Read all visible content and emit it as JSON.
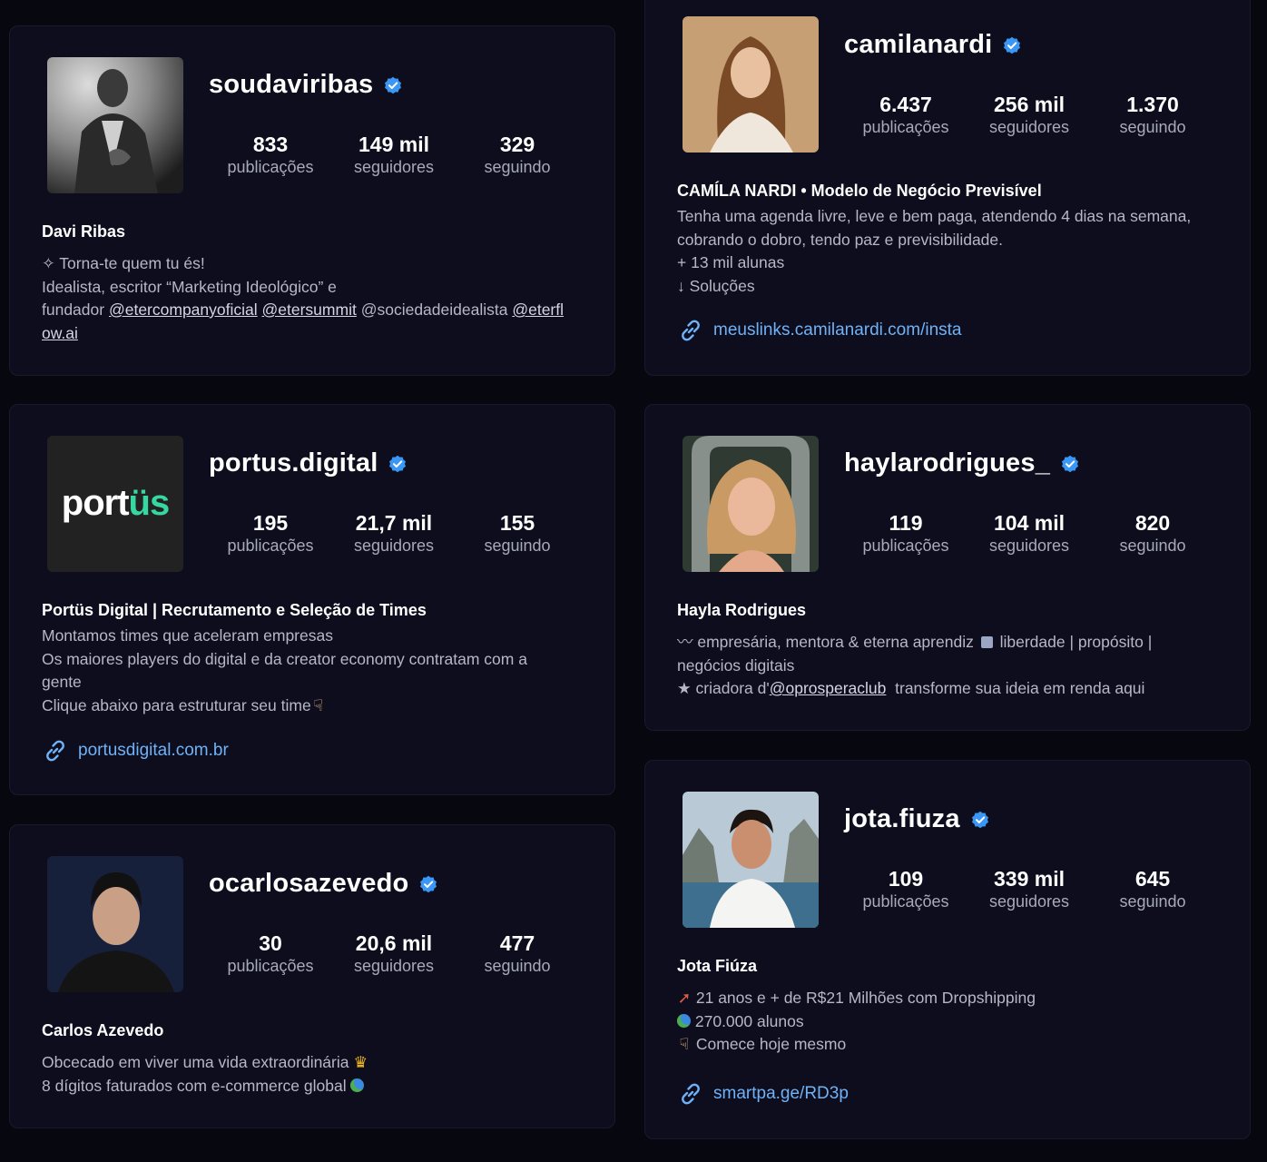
{
  "profiles": [
    {
      "username": "soudaviribas",
      "verified": true,
      "posts": "833",
      "posts_label": "publicações",
      "followers": "149 mil",
      "followers_label": "seguidores",
      "following": "329",
      "following_label": "seguindo",
      "name": "Davi Ribas",
      "bio": {
        "line1": "✧ Torna-te quem tu és!",
        "line2": "Idealista, escritor “Marketing Ideológico” e",
        "line3_prefix": "fundador",
        "mention1": "@etercompanyoficial",
        "mention2": "@etersummit",
        "line3_mid": "@sociedadeidealista",
        "mention3a": "@eterfl",
        "mention3b": "ow.ai"
      }
    },
    {
      "username": "camilanardi",
      "verified": true,
      "posts": "6.437",
      "posts_label": "publicações",
      "followers": "256 mil",
      "followers_label": "seguidores",
      "following": "1.370",
      "following_label": "seguindo",
      "name": "CAMÍLA NARDI • Modelo de Negócio Previsível",
      "bio": {
        "line1": "Tenha uma agenda livre, leve e bem paga, atendendo 4 dias na semana,",
        "line2": "cobrando o dobro, tendo paz e previsibilidade.",
        "line3": "+ 13 mil alunas",
        "line4": "↓ Soluções"
      },
      "link": "meuslinks.camilanardi.com/insta"
    },
    {
      "username": "portus.digital",
      "verified": true,
      "logo_text": "portüs",
      "posts": "195",
      "posts_label": "publicações",
      "followers": "21,7 mil",
      "followers_label": "seguidores",
      "following": "155",
      "following_label": "seguindo",
      "name": "Portüs Digital | Recrutamento e Seleção de Times",
      "bio": {
        "line1": "Montamos times que aceleram empresas",
        "line2": "Os maiores players do digital e da creator economy contratam com a",
        "line3": "gente",
        "line4": "Clique abaixo para estruturar seu time"
      },
      "link": "portusdigital.com.br"
    },
    {
      "username": "haylarodrigues_",
      "verified": true,
      "posts": "119",
      "posts_label": "publicações",
      "followers": "104 mil",
      "followers_label": "seguidores",
      "following": "820",
      "following_label": "seguindo",
      "name": "Hayla Rodrigues",
      "bio": {
        "line1a": "〰 empresária, mentora & eterna aprendiz",
        "line1b": "liberdade | propósito |",
        "line2": "negócios digitais",
        "line3a": "★ criadora d'",
        "mention": "@oprosperaclub",
        "line3b": "transforme sua ideia em renda aqui"
      }
    },
    {
      "username": "ocarlosazevedo",
      "verified": true,
      "posts": "30",
      "posts_label": "publicações",
      "followers": "20,6 mil",
      "followers_label": "seguidores",
      "following": "477",
      "following_label": "seguindo",
      "name": "Carlos Azevedo",
      "bio": {
        "line1": "Obcecado em viver uma vida extraordinária",
        "line2": "8 dígitos faturados com e-commerce global"
      }
    },
    {
      "username": "jota.fiuza",
      "verified": true,
      "posts": "109",
      "posts_label": "publicações",
      "followers": "339 mil",
      "followers_label": "seguidores",
      "following": "645",
      "following_label": "seguindo",
      "name": "Jota Fiúza",
      "bio": {
        "line1": "21 anos e + de R$21 Milhões com Dropshipping",
        "line2": "270.000 alunos",
        "line3": "Comece hoje mesmo"
      },
      "link": "smartpa.ge/RD3p"
    }
  ],
  "colors": {
    "background": "#07070f",
    "card": "#0d0d1d",
    "verified": "#3b97f5",
    "link": "#6fb2f7",
    "portus_green": "#36d7a0"
  },
  "icons": [
    "verified-badge-icon",
    "link-chain-icon"
  ]
}
